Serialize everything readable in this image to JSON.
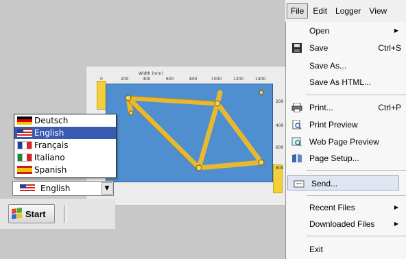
{
  "colors": {
    "canvas_blue": "#4f8fd0",
    "frame_yellow": "#e8b830",
    "selection_blue": "#3a5cb0",
    "menu_highlight": "#dfe6f2"
  },
  "ruler": {
    "caption": "Width (mm)",
    "top_ticks": [
      "0",
      "200",
      "400",
      "600",
      "800",
      "1000",
      "1200",
      "1400"
    ],
    "right_ticks": [
      "200",
      "400",
      "600",
      "800"
    ]
  },
  "languages": {
    "items": [
      {
        "label": "Deutsch",
        "flag": "german-flag-icon"
      },
      {
        "label": "English",
        "flag": "us-flag-icon",
        "selected": true
      },
      {
        "label": "Français",
        "flag": "french-flag-icon"
      },
      {
        "label": "Italiano",
        "flag": "italian-flag-icon"
      },
      {
        "label": "Spanish",
        "flag": "spanish-flag-icon"
      }
    ],
    "selected_label": "English"
  },
  "taskbar": {
    "start_label": "Start"
  },
  "menubar": {
    "items": [
      "File",
      "Edit",
      "Logger",
      "View"
    ],
    "active": "File"
  },
  "file_menu": {
    "open": "Open",
    "save": "Save",
    "save_shortcut": "Ctrl+S",
    "save_as": "Save As...",
    "save_as_html": "Save As HTML...",
    "print": "Print...",
    "print_shortcut": "Ctrl+P",
    "print_preview": "Print Preview",
    "web_page_preview": "Web Page Preview",
    "page_setup": "Page Setup...",
    "send": "Send...",
    "recent_files": "Recent Files",
    "downloaded_files": "Downloaded Files",
    "exit": "Exit"
  }
}
